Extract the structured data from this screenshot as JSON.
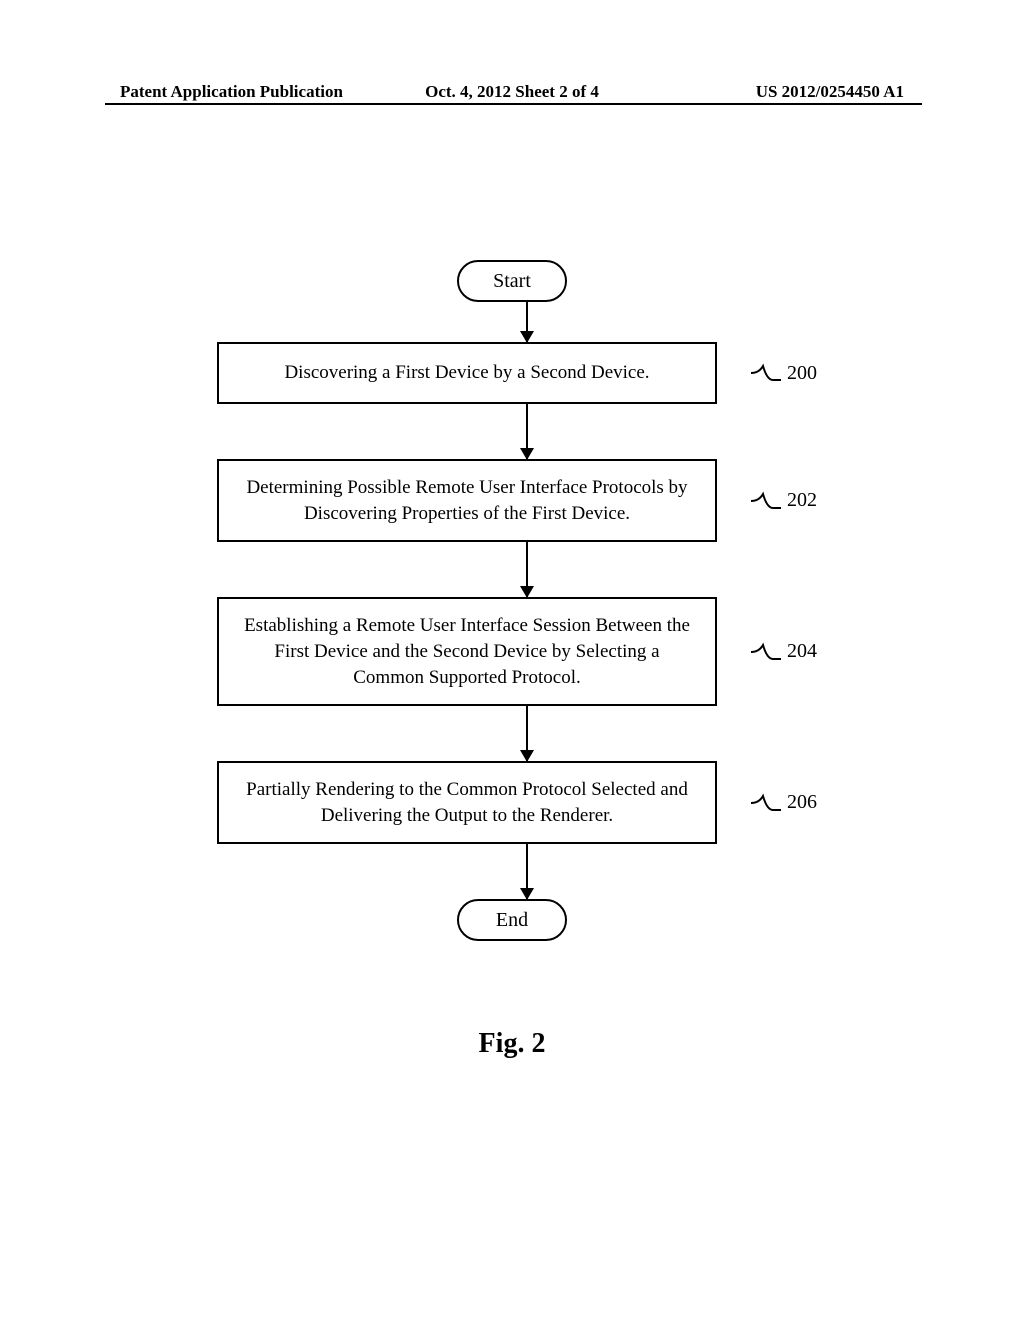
{
  "header": {
    "left": "Patent Application Publication",
    "center": "Oct. 4, 2012  Sheet 2 of 4",
    "right": "US 2012/0254450 A1"
  },
  "flowchart": {
    "start": "Start",
    "end": "End",
    "steps": [
      {
        "text": "Discovering a First Device by a Second Device.",
        "label": "200"
      },
      {
        "text": "Determining Possible Remote User Interface Protocols by Discovering Properties of the First Device.",
        "label": "202"
      },
      {
        "text": "Establishing a Remote User Interface Session Between the First Device and the Second Device by Selecting a Common Supported Protocol.",
        "label": "204"
      },
      {
        "text": "Partially Rendering to the Common Protocol Selected and Delivering the Output to the Renderer.",
        "label": "206"
      }
    ]
  },
  "figure_label": "Fig. 2"
}
